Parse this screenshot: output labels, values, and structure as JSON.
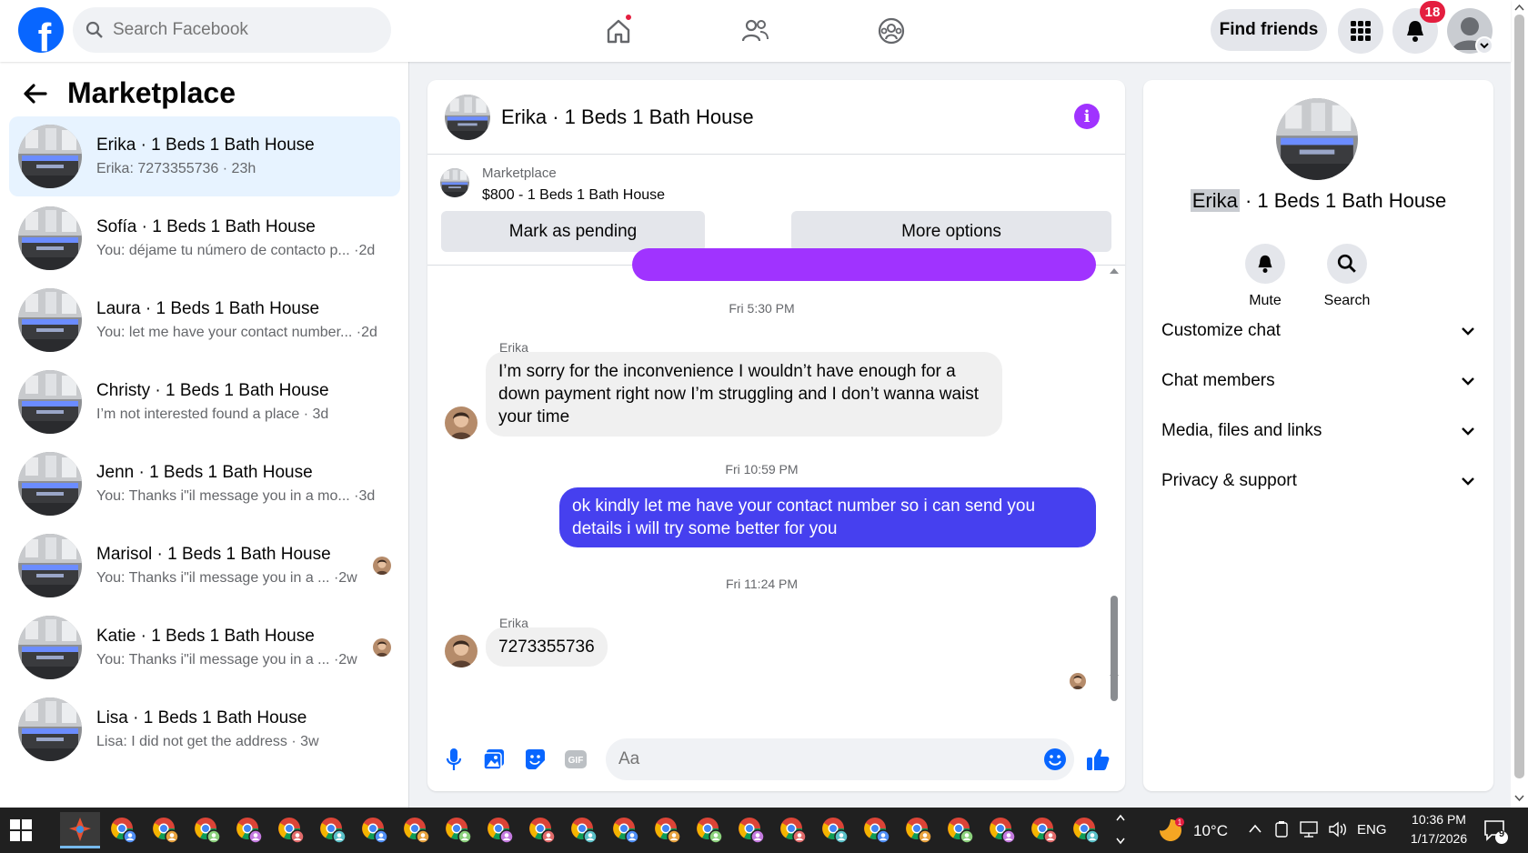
{
  "topbar": {
    "logo": "f",
    "search_placeholder": "Search Facebook",
    "find_friends": "Find friends",
    "notifications_count": "18"
  },
  "left": {
    "title": "Marketplace",
    "conversations": [
      {
        "name": "Erika · 1 Beds 1 Bath House",
        "preview": "Erika: 7273355736 · 23h"
      },
      {
        "name": "Sofía · 1 Beds 1 Bath House",
        "preview": "You: déjame tu número de contacto p... ·2d"
      },
      {
        "name": "Laura · 1 Beds 1 Bath House",
        "preview": "You: let me have your contact number... ·2d"
      },
      {
        "name": "Christy · 1 Beds 1 Bath House",
        "preview": "I’m not interested found a place · 3d"
      },
      {
        "name": "Jenn · 1 Beds 1 Bath House",
        "preview": "You: Thanks i\"il message you in a mo...  ·3d"
      },
      {
        "name": "Marisol · 1 Beds 1 Bath House",
        "preview": "You: Thanks i\"il message you in a ...  ·2w"
      },
      {
        "name": "Katie · 1 Beds 1 Bath House",
        "preview": "You: Thanks i\"il message you in a ...  ·2w"
      },
      {
        "name": "Lisa · 1 Beds 1 Bath House",
        "preview": "Lisa: I did not get the address · 3w"
      }
    ]
  },
  "chat": {
    "title": "Erika · 1 Beds 1 Bath House",
    "listing_source": "Marketplace",
    "listing_title": "$800 - 1 Beds 1 Bath House",
    "mark_pending": "Mark as pending",
    "more_options": "More options",
    "messages": [
      {
        "timestamp": "Fri 5:30 PM"
      },
      {
        "sender": "Erika",
        "text": "I’m sorry for the inconvenience I wouldn’t have enough for a down payment right now I’m struggling and I don’t wanna waist your time"
      },
      {
        "timestamp": "Fri 10:59 PM"
      },
      {
        "outgoing": "ok kindly let me have your contact number so i can send you details i will try some better for you"
      },
      {
        "timestamp": "Fri 11:24 PM"
      },
      {
        "sender": "Erika",
        "text": "7273355736"
      }
    ],
    "composer_placeholder": "Aa"
  },
  "right": {
    "name_first": "Erika",
    "name_rest": " · 1 Beds 1 Bath House",
    "mute": "Mute",
    "search": "Search",
    "sections": [
      "Customize chat",
      "Chat members",
      "Media, files and links",
      "Privacy & support"
    ]
  },
  "taskbar": {
    "weather": "10°C",
    "lang": "ENG",
    "time": "10:36 PM",
    "date": "1/17/2026",
    "notif_count": "9"
  },
  "colors": {
    "brand": "#0866ff",
    "outgoing_bubble": "#4640ef",
    "info_accent": "#a033ff",
    "active_convo": "#e7f3ff"
  }
}
